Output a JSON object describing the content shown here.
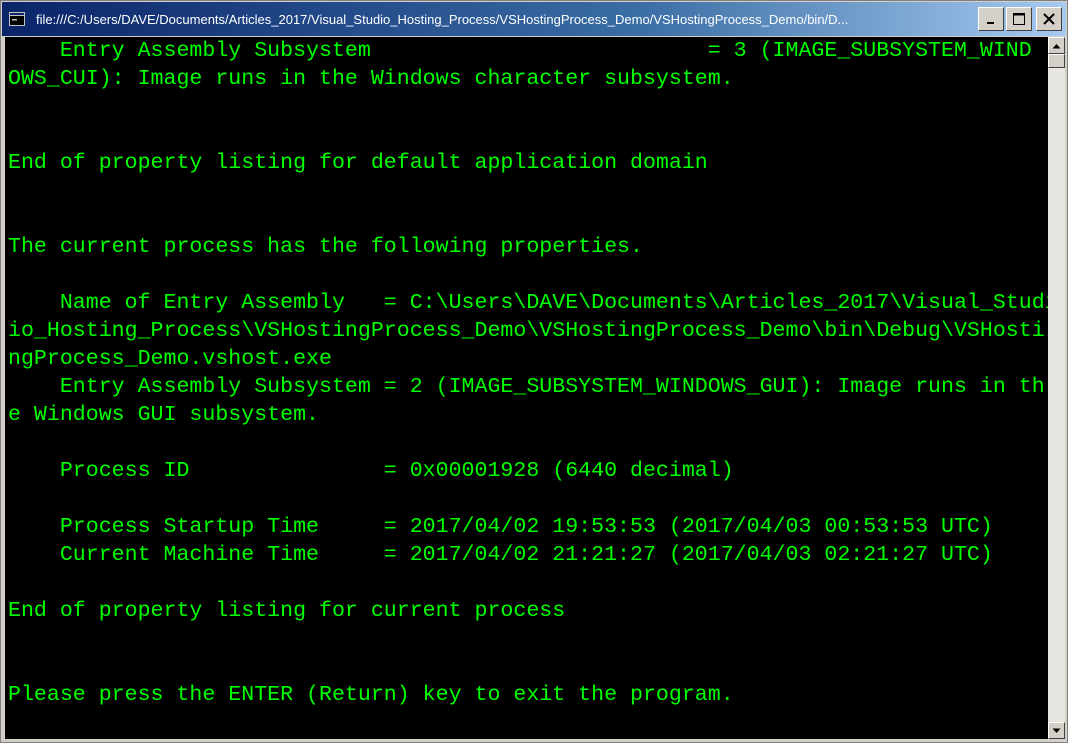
{
  "window": {
    "title": "file:///C:/Users/DAVE/Documents/Articles_2017/Visual_Studio_Hosting_Process/VSHostingProcess_Demo/VSHostingProcess_Demo/bin/D..."
  },
  "icons": {
    "system": "console-window-icon",
    "minimize": "minimize-icon",
    "maximize": "maximize-icon",
    "close": "close-icon",
    "scroll_up": "chevron-up-icon",
    "scroll_down": "chevron-down-icon"
  },
  "colors": {
    "console_background": "#000000",
    "console_text": "#00ff00",
    "titlebar_start": "#0a246a",
    "titlebar_end": "#a6caf0"
  },
  "console": {
    "lines": [
      "    Entry Assembly Subsystem                          = 3 (IMAGE_SUBSYSTEM_WIND",
      "OWS_CUI): Image runs in the Windows character subsystem.",
      "",
      "",
      "End of property listing for default application domain",
      "",
      "",
      "The current process has the following properties.",
      "",
      "    Name of Entry Assembly   = C:\\Users\\DAVE\\Documents\\Articles_2017\\Visual_Studi",
      "io_Hosting_Process\\VSHostingProcess_Demo\\VSHostingProcess_Demo\\bin\\Debug\\VSHosti",
      "ngProcess_Demo.vshost.exe",
      "    Entry Assembly Subsystem = 2 (IMAGE_SUBSYSTEM_WINDOWS_GUI): Image runs in th",
      "e Windows GUI subsystem.",
      "",
      "    Process ID               = 0x00001928 (6440 decimal)",
      "",
      "    Process Startup Time     = 2017/04/02 19:53:53 (2017/04/03 00:53:53 UTC)",
      "    Current Machine Time     = 2017/04/02 21:21:27 (2017/04/03 02:21:27 UTC)",
      "",
      "End of property listing for current process",
      "",
      "",
      "Please press the ENTER (Return) key to exit the program."
    ]
  }
}
